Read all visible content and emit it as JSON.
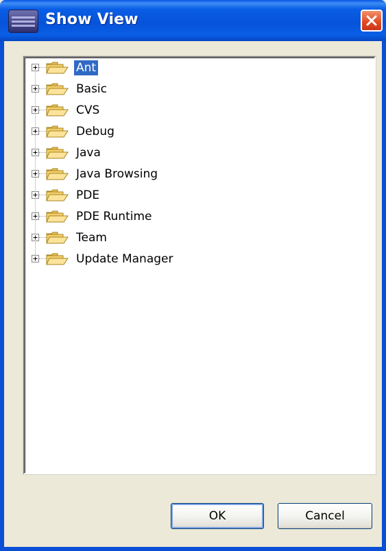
{
  "window": {
    "title": "Show View",
    "icon": "eclipse-app-icon",
    "close_icon": "close-icon"
  },
  "tree": {
    "items": [
      {
        "label": "Ant",
        "selected": true,
        "expanded": false
      },
      {
        "label": "Basic",
        "selected": false,
        "expanded": false
      },
      {
        "label": "CVS",
        "selected": false,
        "expanded": false
      },
      {
        "label": "Debug",
        "selected": false,
        "expanded": false
      },
      {
        "label": "Java",
        "selected": false,
        "expanded": false
      },
      {
        "label": "Java Browsing",
        "selected": false,
        "expanded": false
      },
      {
        "label": "PDE",
        "selected": false,
        "expanded": false
      },
      {
        "label": "PDE Runtime",
        "selected": false,
        "expanded": false
      },
      {
        "label": "Team",
        "selected": false,
        "expanded": false
      },
      {
        "label": "Update Manager",
        "selected": false,
        "expanded": false
      }
    ]
  },
  "buttons": {
    "ok_label": "OK",
    "cancel_label": "Cancel"
  },
  "colors": {
    "titlebar": "#0a5ee6",
    "selection": "#316ac5",
    "folder": "#f6d47a",
    "dialog_bg": "#ece9d8"
  }
}
